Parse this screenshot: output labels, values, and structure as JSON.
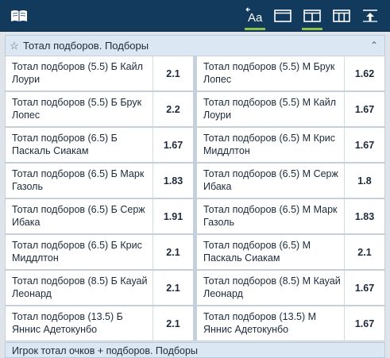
{
  "toolbar": {
    "icons": [
      "book-icon",
      "text-size-icon",
      "single-column-icon",
      "two-column-icon",
      "three-column-icon",
      "scroll-top-icon"
    ],
    "text_size_glyph": "Aa"
  },
  "section": {
    "title": "Тотал подборов. Подборы",
    "rows": [
      {
        "left": {
          "name": "Тотал подборов (5.5) Б Кайл Лоури",
          "odds": "2.1"
        },
        "right": {
          "name": "Тотал подборов (5.5) М Брук Лопес",
          "odds": "1.62"
        }
      },
      {
        "left": {
          "name": "Тотал подборов (5.5) Б Брук Лопес",
          "odds": "2.2"
        },
        "right": {
          "name": "Тотал подборов (5.5) М Кайл Лоури",
          "odds": "1.67"
        }
      },
      {
        "left": {
          "name": "Тотал подборов (6.5) Б Паскаль Сиакам",
          "odds": "1.67"
        },
        "right": {
          "name": "Тотал подборов (6.5) М Крис Миддлтон",
          "odds": "1.67"
        }
      },
      {
        "left": {
          "name": "Тотал подборов (6.5) Б Марк Газоль",
          "odds": "1.83"
        },
        "right": {
          "name": "Тотал подборов (6.5) М Серж Ибака",
          "odds": "1.8"
        }
      },
      {
        "left": {
          "name": "Тотал подборов (6.5) Б Серж Ибака",
          "odds": "1.91"
        },
        "right": {
          "name": "Тотал подборов (6.5) М Марк Газоль",
          "odds": "1.83"
        }
      },
      {
        "left": {
          "name": "Тотал подборов (6.5) Б Крис Миддлтон",
          "odds": "2.1"
        },
        "right": {
          "name": "Тотал подборов (6.5) М Паскаль Сиакам",
          "odds": "2.1"
        }
      },
      {
        "left": {
          "name": "Тотал подборов (8.5) Б Кауай Леонард",
          "odds": "2.1"
        },
        "right": {
          "name": "Тотал подборов (8.5) М Кауай Леонард",
          "odds": "1.67"
        }
      },
      {
        "left": {
          "name": "Тотал подборов (13.5) Б Яннис Адетокунбо",
          "odds": "2.1"
        },
        "right": {
          "name": "Тотал подборов (13.5) М Яннис Адетокунбо",
          "odds": "1.67"
        }
      }
    ]
  },
  "next_section": {
    "title": "Игрок тотал очков + подборов. Подборы"
  },
  "colors": {
    "toolbar_bg": "#123a5c",
    "active_underline": "#8bc24a",
    "header_bg": "#dbe7f2"
  }
}
